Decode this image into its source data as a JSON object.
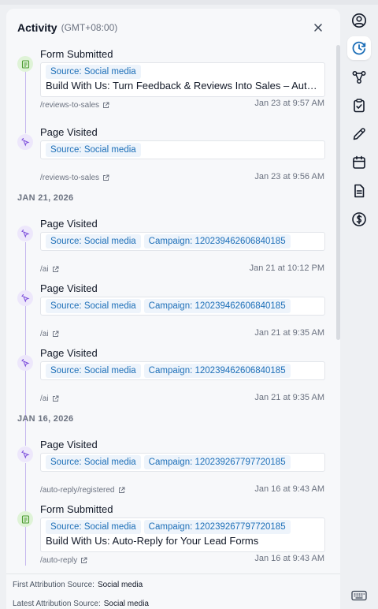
{
  "panel": {
    "title": "Activity",
    "timezone": "(GMT+08:00)"
  },
  "groups": [
    {
      "date": ""
    },
    {
      "date": "JAN 21, 2026"
    },
    {
      "date": "JAN 16, 2026"
    }
  ],
  "items": [
    {
      "type": "form",
      "title": "Form Submitted",
      "chips": [
        "Source: Social media"
      ],
      "text": "Build With Us: Turn Feedback & Reviews Into Sales – Automated Revie",
      "link": "/reviews-to-sales",
      "time": "Jan 23 at 9:57 AM"
    },
    {
      "type": "visit",
      "title": "Page Visited",
      "chips": [
        "Source: Social media"
      ],
      "text": "",
      "link": "/reviews-to-sales",
      "time": "Jan 23 at 9:56 AM"
    },
    {
      "type": "visit",
      "title": "Page Visited",
      "chips": [
        "Source: Social media",
        "Campaign: 120239462606840185"
      ],
      "text": "",
      "link": "/ai",
      "time": "Jan 21 at 10:12 PM"
    },
    {
      "type": "visit",
      "title": "Page Visited",
      "chips": [
        "Source: Social media",
        "Campaign: 120239462606840185"
      ],
      "text": "",
      "link": "/ai",
      "time": "Jan 21 at 9:35 AM"
    },
    {
      "type": "visit",
      "title": "Page Visited",
      "chips": [
        "Source: Social media",
        "Campaign: 120239462606840185"
      ],
      "text": "",
      "link": "/ai",
      "time": "Jan 21 at 9:35 AM"
    },
    {
      "type": "visit",
      "title": "Page Visited",
      "chips": [
        "Source: Social media",
        "Campaign: 120239267797720185"
      ],
      "text": "",
      "link": "/auto-reply/registered",
      "time": "Jan 16 at 9:43 AM"
    },
    {
      "type": "form",
      "title": "Form Submitted",
      "chips": [
        "Source: Social media",
        "Campaign: 120239267797720185"
      ],
      "text": "Build With Us: Auto-Reply for Your Lead Forms",
      "link": "/auto-reply",
      "time": "Jan 16 at 9:43 AM"
    }
  ],
  "footer": {
    "first_label": "First Attribution Source:",
    "first_value": "Social media",
    "latest_label": "Latest Attribution Source:",
    "latest_value": "Social media"
  },
  "rail": {
    "icons": [
      "user-circle-icon",
      "clock-activity-icon",
      "workflow-icon",
      "clipboard-check-icon",
      "pencil-icon",
      "calendar-icon",
      "document-icon",
      "dollar-icon"
    ],
    "active": "clock-activity-icon",
    "bottom_icon": "keyboard-icon"
  },
  "colors": {
    "accent": "#1d6fb8",
    "chip_bg": "#eef4fb",
    "form_icon": "#4a9b2f",
    "visit_icon": "#7c4ddb"
  }
}
